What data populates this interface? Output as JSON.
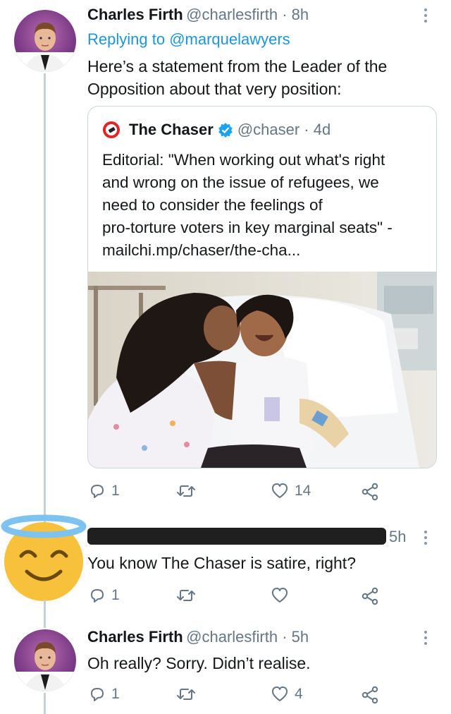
{
  "tweet1": {
    "display_name": "Charles Firth",
    "handle_time": "@charlesfirth · 8h",
    "replying_prefix": "Replying to ",
    "replying_handle": "@marquelawyers",
    "text_line1": "Here’s a statement from the Leader of the",
    "text_line2": "Opposition about that very position:",
    "quote": {
      "display_name": "The Chaser",
      "handle_time": "@chaser · 4d",
      "lines": [
        "Editorial: \"When working out what's right",
        "and wrong on the issue of refugees, we",
        "need to consider the feelings of",
        "pro-torture voters in key marginal seats\" -",
        "mailchi.mp/chaser/the-cha..."
      ]
    },
    "reply_count": "1",
    "retweet_count": "",
    "like_count": "14"
  },
  "tweet2": {
    "time": "5h",
    "text": "You know The Chaser is satire, right?",
    "reply_count": "1",
    "like_count": ""
  },
  "tweet3": {
    "display_name": "Charles Firth",
    "handle_time": "@charlesfirth · 5h",
    "text": "Oh really? Sorry. Didn’t realise.",
    "reply_count": "1",
    "like_count": "4"
  },
  "colors": {
    "accent": "#1b95e0",
    "muted": "#657786",
    "verified": "#1da1f2",
    "emoji_face": "#f7c13c",
    "halo": "#7ec3ef"
  },
  "icons": [
    "reply-icon",
    "retweet-icon",
    "heart-icon",
    "share-icon",
    "more-icon",
    "verified-icon",
    "chaser-logo-icon",
    "halo-emoji-icon"
  ]
}
